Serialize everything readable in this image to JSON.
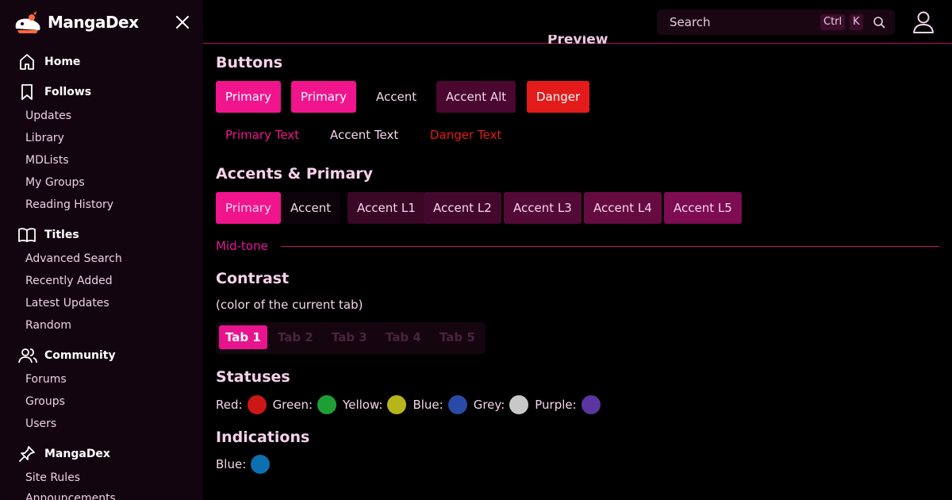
{
  "app": {
    "name": "MangaDex"
  },
  "sidebar": {
    "sections": [
      {
        "label": "Home",
        "icon": "home-icon"
      },
      {
        "label": "Follows",
        "icon": "bookmark-icon",
        "items": [
          "Updates",
          "Library",
          "MDLists",
          "My Groups",
          "Reading History"
        ]
      },
      {
        "label": "Titles",
        "icon": "book-open-icon",
        "items": [
          "Advanced Search",
          "Recently Added",
          "Latest Updates",
          "Random"
        ]
      },
      {
        "label": "Community",
        "icon": "users-icon",
        "items": [
          "Forums",
          "Groups",
          "Users"
        ]
      },
      {
        "label": "MangaDex",
        "icon": "pin-icon",
        "items": [
          "Site Rules",
          "Announcements"
        ]
      }
    ]
  },
  "header": {
    "search_placeholder": "Search",
    "shortcut_keys": [
      "Ctrl",
      "K"
    ],
    "peek_heading": "Preview"
  },
  "main": {
    "buttons_heading": "Buttons",
    "buttons": [
      {
        "label": "Primary",
        "bg": "#f0148d",
        "fg": "#ffffff"
      },
      {
        "label": "Primary",
        "bg": "#f0148d",
        "fg": "#ffffff"
      },
      {
        "label": "Accent",
        "bg": "#000000",
        "fg": "#f4d6ea"
      },
      {
        "label": "Accent Alt",
        "bg": "#4a0830",
        "fg": "#f4d6ea"
      },
      {
        "label": "Danger",
        "bg": "#e41b1b",
        "fg": "#ffffff"
      }
    ],
    "text_buttons": [
      {
        "label": "Primary Text",
        "fg": "#f0148d"
      },
      {
        "label": "Accent Text",
        "fg": "#f4d6ea"
      },
      {
        "label": "Danger Text",
        "fg": "#e41b1b"
      }
    ],
    "accents_heading": "Accents & Primary",
    "accents": [
      {
        "label": "Primary",
        "bg": "#f0148d",
        "fg": "#f8d8ec"
      },
      {
        "label": "Accent",
        "bg": "#0c030a",
        "fg": "#f4d6ea"
      },
      {
        "label": "Accent L1",
        "bg": "#3a0726",
        "fg": "#f4d6ea"
      },
      {
        "label": "Accent L2",
        "bg": "#45082d",
        "fg": "#f4d6ea"
      },
      {
        "label": "Accent L3",
        "bg": "#540a37",
        "fg": "#f4d6ea"
      },
      {
        "label": "Accent L4",
        "bg": "#650b42",
        "fg": "#f4d6ea"
      },
      {
        "label": "Accent L5",
        "bg": "#7d0c52",
        "fg": "#f4d6ea"
      }
    ],
    "midtone_label": "Mid-tone",
    "contrast_heading": "Contrast",
    "contrast_note": "(color of the current tab)",
    "tabs": [
      "Tab 1",
      "Tab 2",
      "Tab 3",
      "Tab 4",
      "Tab 5"
    ],
    "active_tab": "Tab 1",
    "statuses_heading": "Statuses",
    "statuses": [
      {
        "label": "Red:",
        "color": "#cc1717"
      },
      {
        "label": "Green:",
        "color": "#1f9e34"
      },
      {
        "label": "Yellow:",
        "color": "#b7b51c"
      },
      {
        "label": "Blue:",
        "color": "#2a4aa8"
      },
      {
        "label": "Grey:",
        "color": "#c8c8c8"
      },
      {
        "label": "Purple:",
        "color": "#5b36a0"
      }
    ],
    "indications_heading": "Indications",
    "indications": [
      {
        "label": "Blue:",
        "color": "#0b6fb0"
      }
    ]
  }
}
